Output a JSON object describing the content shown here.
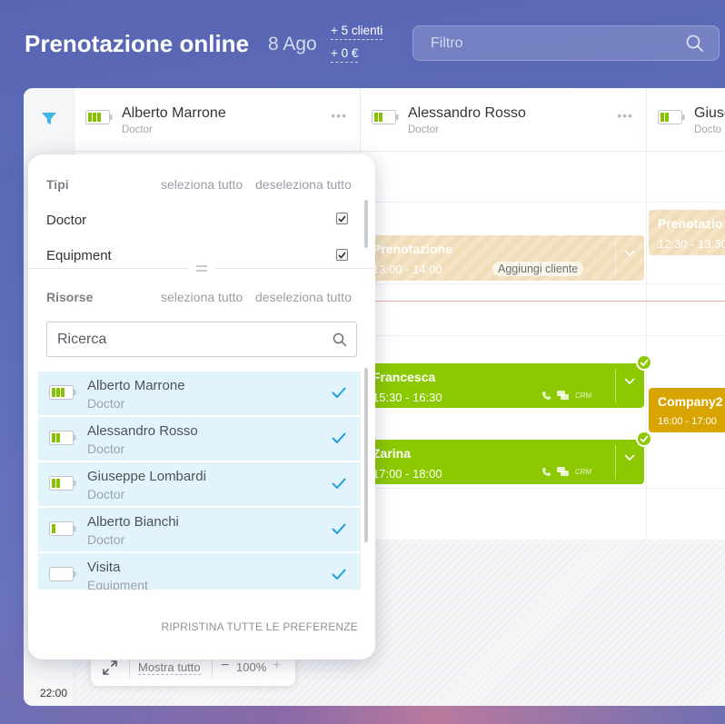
{
  "header": {
    "title": "Prenotazione online",
    "date": "8 Ago",
    "stats": [
      "+ 5 clienti",
      "+ 0 €"
    ],
    "filter_placeholder": "Filtro"
  },
  "resources": [
    {
      "name": "Alberto Marrone",
      "role": "Doctor"
    },
    {
      "name": "Alessandro Rosso",
      "role": "Doctor"
    },
    {
      "name": "Giuseppe Lombardi",
      "role": "Doctor"
    }
  ],
  "resources_visible_names": [
    "Alberto Marrone",
    "Alessandro Rosso",
    "Giuse"
  ],
  "resources_visible_roles": [
    "Doctor",
    "Doctor",
    "Docto"
  ],
  "events": {
    "pending_a": {
      "name": "Prenotazione",
      "time": "13:00 - 14:00",
      "action": "Aggiungi cliente"
    },
    "pending_b": {
      "name": "Prenotazio",
      "time": "12:30 - 13:30"
    },
    "francesca": {
      "name": "Francesca",
      "time": "15:30 - 16:30",
      "crm": "CRM"
    },
    "company": {
      "name": "Company2",
      "time": "16:00 - 17:00"
    },
    "zarina": {
      "name": "Zarina",
      "time": "17:00 - 18:00",
      "crm": "CRM"
    }
  },
  "calendar": {
    "time_label": "22:00",
    "zoom": {
      "show_all": "Mostra tutto",
      "minus": "−",
      "value": "100%",
      "plus": "+"
    }
  },
  "filter_panel": {
    "types_heading": "Tipi",
    "select_all": "seleziona tutto",
    "deselect_all": "deseleziona tutto",
    "types": [
      {
        "label": "Doctor",
        "checked": true
      },
      {
        "label": "Equipment",
        "checked": true
      }
    ],
    "resources_heading": "Risorse",
    "search_placeholder": "Ricerca",
    "resource_items": [
      {
        "name": "Alberto Marrone",
        "role": "Doctor",
        "selected": true
      },
      {
        "name": "Alessandro Rosso",
        "role": "Doctor",
        "selected": true
      },
      {
        "name": "Giuseppe Lombardi",
        "role": "Doctor",
        "selected": true
      },
      {
        "name": "Alberto Bianchi",
        "role": "Doctor",
        "selected": true
      },
      {
        "name": "Visita",
        "role": "Equipment",
        "selected": true
      }
    ],
    "reset_label": "RIPRISTINA TUTTE LE PREFERENZE"
  },
  "colors": {
    "accent": "#1e9fd6",
    "confirmed": "#8cc900",
    "company": "#d8a400",
    "pending": "#f0dcb6"
  }
}
